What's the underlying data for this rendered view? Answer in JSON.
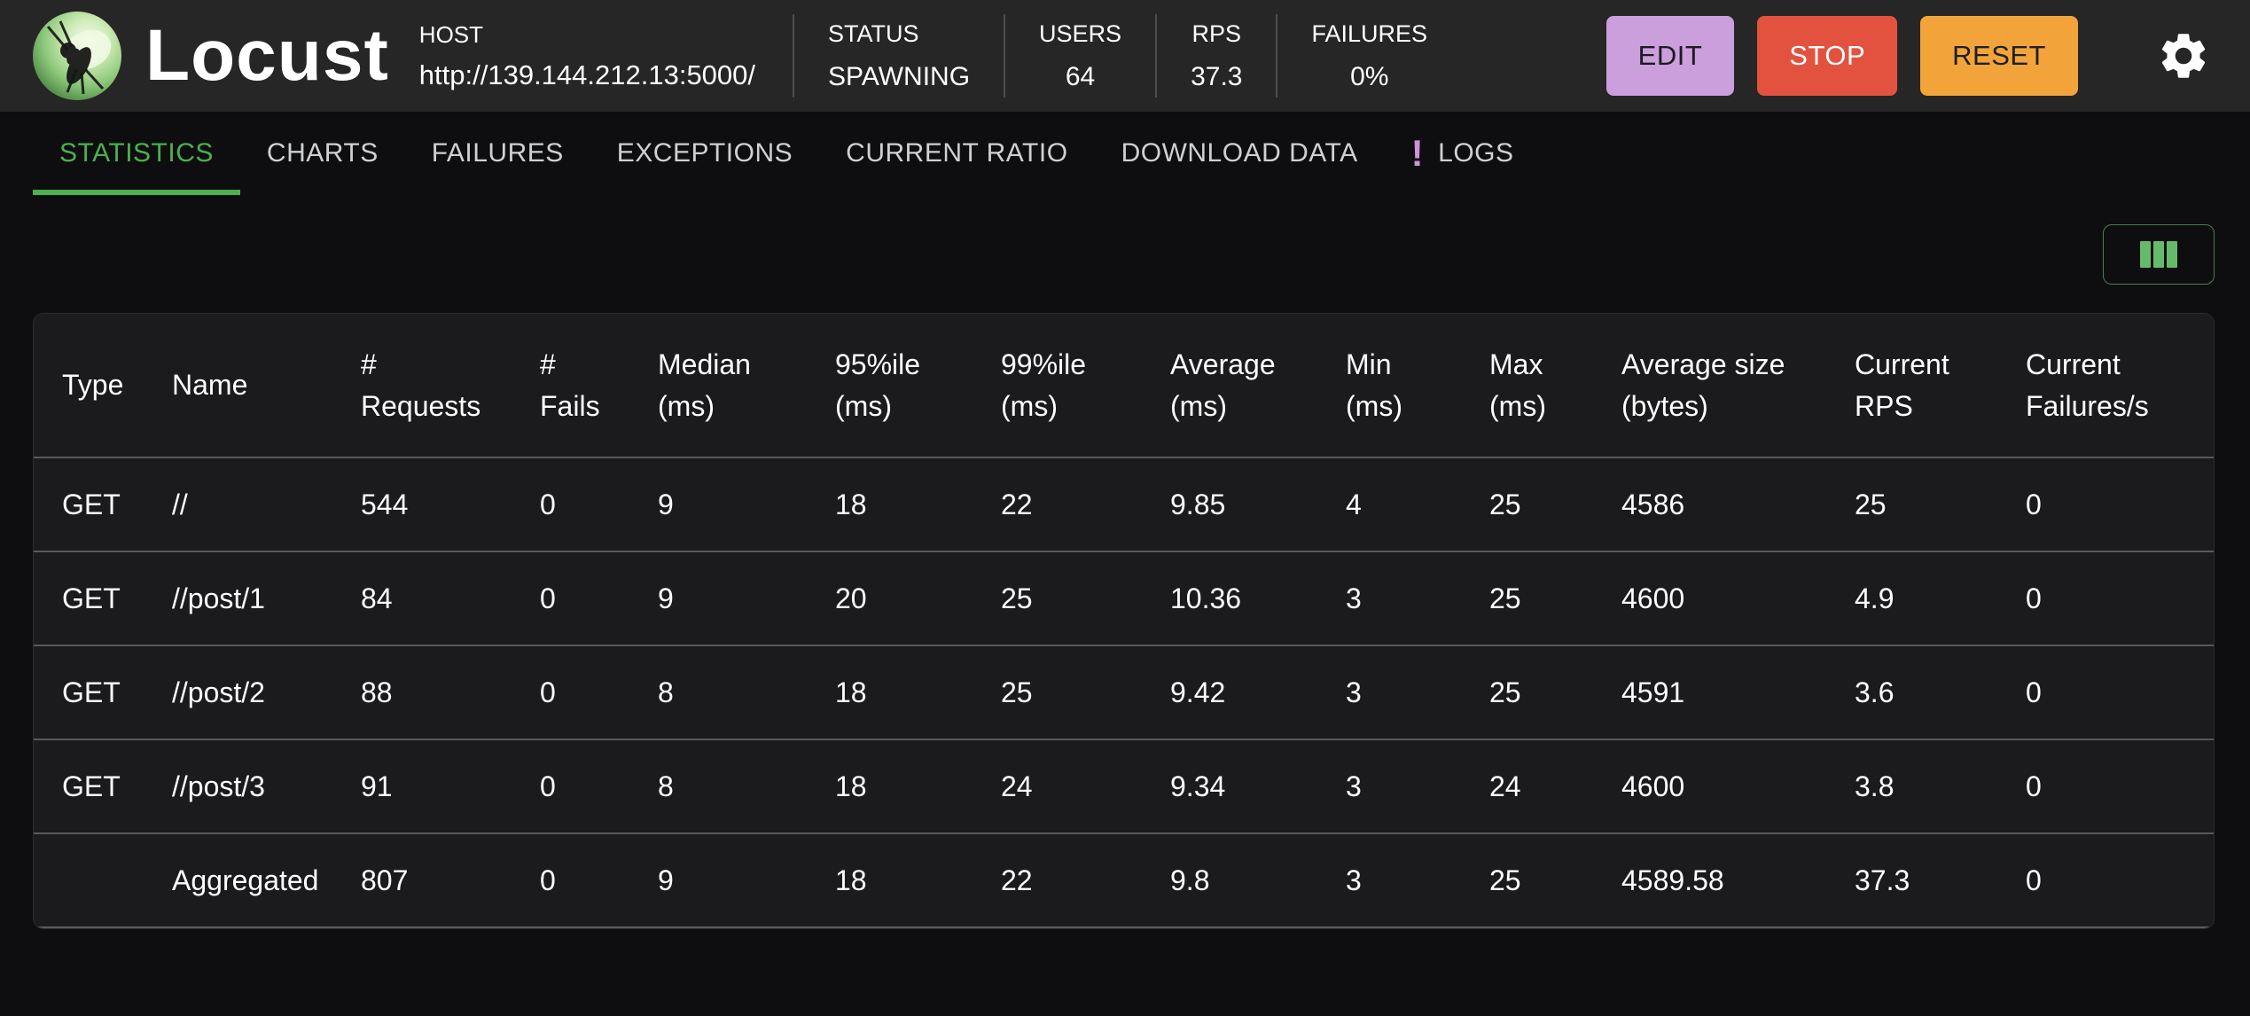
{
  "header": {
    "title": "Locust",
    "host_label": "HOST",
    "host_url": "http://139.144.212.13:5000/",
    "stats": [
      {
        "label": "STATUS",
        "value": "SPAWNING"
      },
      {
        "label": "USERS",
        "value": "64"
      },
      {
        "label": "RPS",
        "value": "37.3"
      },
      {
        "label": "FAILURES",
        "value": "0%"
      }
    ],
    "buttons": [
      {
        "label": "EDIT",
        "bg": "#ca9fdc",
        "text": "#1e1b20"
      },
      {
        "label": "STOP",
        "bg": "#e3523f",
        "text": "#ffffff"
      },
      {
        "label": "RESET",
        "bg": "#f2a43b",
        "text": "#1f1f1f"
      }
    ],
    "settings_icon": "gear-icon"
  },
  "tabs": [
    {
      "label": "STATISTICS",
      "active": true
    },
    {
      "label": "CHARTS",
      "active": false
    },
    {
      "label": "FAILURES",
      "active": false
    },
    {
      "label": "EXCEPTIONS",
      "active": false
    },
    {
      "label": "CURRENT RATIO",
      "active": false
    },
    {
      "label": "DOWNLOAD DATA",
      "active": false
    },
    {
      "label": "LOGS",
      "active": false,
      "badge": "!"
    }
  ],
  "toolbar": {
    "column_button_icon": "columns-icon"
  },
  "table": {
    "columns": [
      "Type",
      "Name",
      "#\nRequests",
      "#\nFails",
      "Median\n(ms)",
      "95%ile\n(ms)",
      "99%ile\n(ms)",
      "Average\n(ms)",
      "Min\n(ms)",
      "Max\n(ms)",
      "Average size\n(bytes)",
      "Current\nRPS",
      "Current\nFailures/s"
    ],
    "rows": [
      [
        "GET",
        "//",
        "544",
        "0",
        "9",
        "18",
        "22",
        "9.85",
        "4",
        "25",
        "4586",
        "25",
        "0"
      ],
      [
        "GET",
        "//post/1",
        "84",
        "0",
        "9",
        "20",
        "25",
        "10.36",
        "3",
        "25",
        "4600",
        "4.9",
        "0"
      ],
      [
        "GET",
        "//post/2",
        "88",
        "0",
        "8",
        "18",
        "25",
        "9.42",
        "3",
        "25",
        "4591",
        "3.6",
        "0"
      ],
      [
        "GET",
        "//post/3",
        "91",
        "0",
        "8",
        "18",
        "24",
        "9.34",
        "3",
        "24",
        "4600",
        "3.8",
        "0"
      ],
      [
        "",
        "Aggregated",
        "807",
        "0",
        "9",
        "18",
        "22",
        "9.8",
        "3",
        "25",
        "4589.58",
        "37.3",
        "0"
      ]
    ]
  },
  "colors": {
    "accent_green": "#4caf50",
    "badge_purple": "#ce93d8",
    "edit_button": "#ca9fdc",
    "stop_button": "#e3523f",
    "reset_button": "#f2a43b",
    "header_bg": "#262626",
    "page_bg": "#0e0e10",
    "card_bg": "#1b1b1d"
  }
}
